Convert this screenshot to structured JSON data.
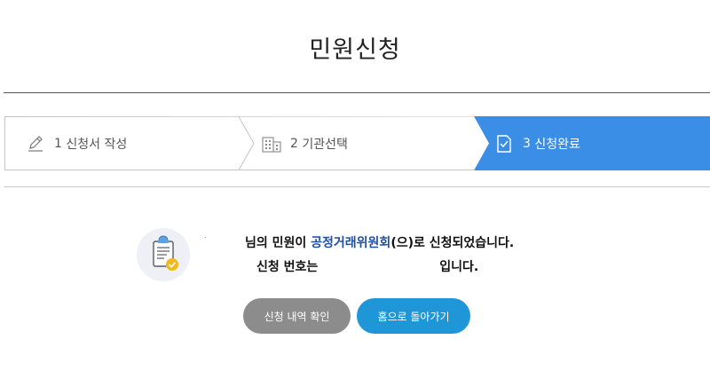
{
  "page": {
    "title": "민원신청"
  },
  "stepper": {
    "steps": [
      {
        "number": "1",
        "label": "신청서 작성",
        "icon": "pencil-icon",
        "state": "done"
      },
      {
        "number": "2",
        "label": "기관선택",
        "icon": "building-icon",
        "state": "done"
      },
      {
        "number": "3",
        "label": "신청완료",
        "icon": "document-check-icon",
        "state": "active"
      }
    ],
    "active_color": "#3a8ee6"
  },
  "result": {
    "line1_suffix": "님의 민원이 ",
    "agency": "공정거래위원회",
    "line1_end": "(으)로 신청되었습니다.",
    "line2_prefix": "신청 번호는",
    "line2_suffix": "입니다.",
    "icon": "clipboard-check-icon",
    "agency_color": "#1f4ea3"
  },
  "buttons": {
    "history_label": "신청 내역 확인",
    "home_label": "홈으로 돌아가기",
    "history_color": "#8c8c8c",
    "home_color": "#1e96d8"
  }
}
